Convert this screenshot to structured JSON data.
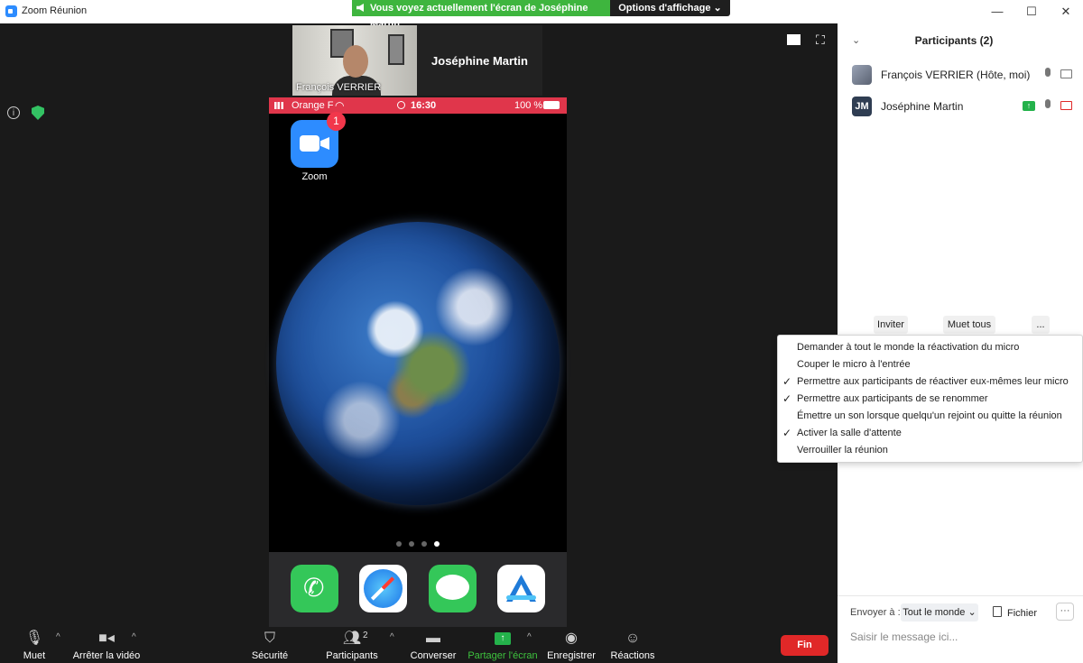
{
  "window": {
    "title": "Zoom Réunion",
    "minimize": "—",
    "maximize": "☐",
    "close": "✕"
  },
  "share_banner": {
    "text": "Vous voyez actuellement l'écran de Joséphine Martin",
    "view_options": "Options d'affichage ⌄"
  },
  "thumbnails": [
    {
      "name": "François VERRIER"
    },
    {
      "name": "Joséphine Martin"
    }
  ],
  "phone": {
    "carrier": "Orange F",
    "time": "16:30",
    "battery": "100 %",
    "zoom_app_label": "Zoom",
    "zoom_badge": "1",
    "page_dots": 4,
    "active_page": 3
  },
  "toolbar": {
    "mute": "Muet",
    "stop_video": "Arrêter la vidéo",
    "security": "Sécurité",
    "participants": "Participants",
    "participants_count": "2",
    "chat": "Converser",
    "share": "Partager l'écran",
    "record": "Enregistrer",
    "reactions": "Réactions",
    "end": "Fin"
  },
  "panel": {
    "title": "Participants (2)",
    "participants": [
      {
        "name": "François VERRIER (Hôte, moi)"
      },
      {
        "name": "Joséphine Martin",
        "initials": "JM"
      }
    ],
    "invite": "Inviter",
    "mute_all": "Muet tous",
    "more": "..."
  },
  "menu": {
    "items": [
      {
        "label": "Demander à tout le monde la réactivation du micro",
        "checked": false
      },
      {
        "label": "Couper le micro à l'entrée",
        "checked": false
      },
      {
        "label": "Permettre aux participants de réactiver eux-mêmes leur micro",
        "checked": true
      },
      {
        "label": "Permettre aux participants de se renommer",
        "checked": true
      },
      {
        "label": "Émettre un son lorsque quelqu'un rejoint ou quitte la réunion",
        "checked": false
      },
      {
        "label": "Activer la salle d'attente",
        "checked": true
      },
      {
        "label": "Verrouiller la réunion",
        "checked": false
      }
    ]
  },
  "chat": {
    "send_to_label": "Envoyer à :",
    "recipient": "Tout le monde",
    "file": "Fichier",
    "more": "···",
    "placeholder": "Saisir le message ici..."
  },
  "colors": {
    "banner_green": "#3eb53e",
    "end_red": "#e02828",
    "zoom_blue": "#2d8cff",
    "phone_status_red": "#e0364b"
  }
}
